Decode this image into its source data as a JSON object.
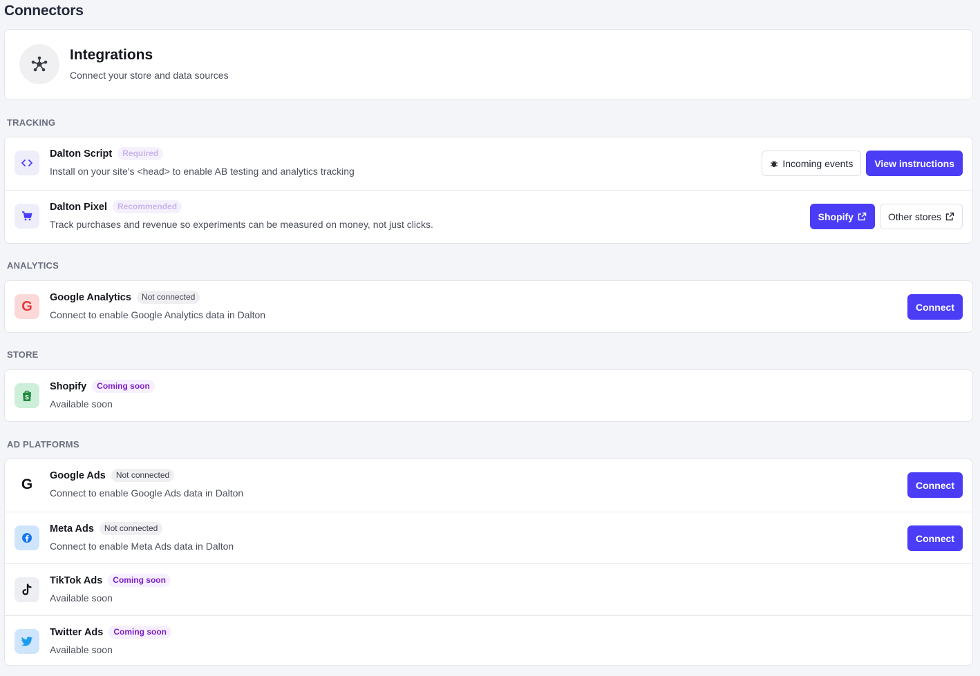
{
  "page": {
    "title": "Connectors"
  },
  "hero": {
    "title": "Integrations",
    "subtitle": "Connect your store and data sources",
    "icon": "network-icon"
  },
  "sections": {
    "tracking": {
      "label": "TRACKING",
      "items": [
        {
          "name": "Dalton Script",
          "badge": "Required",
          "description": "Install on your site's <head> to enable AB testing and analytics tracking",
          "icon": "code-icon",
          "actions": {
            "incoming_events": "Incoming events",
            "view_instructions": "View instructions"
          }
        },
        {
          "name": "Dalton Pixel",
          "badge": "Recommended",
          "description": "Track purchases and revenue so experiments can be measured on money, not just clicks.",
          "icon": "cart-icon",
          "actions": {
            "shopify": "Shopify",
            "other_stores": "Other stores"
          }
        }
      ]
    },
    "analytics": {
      "label": "ANALYTICS",
      "items": [
        {
          "name": "Google Analytics",
          "badge": "Not connected",
          "description": "Connect to enable Google Analytics data in Dalton",
          "icon": "google-analytics-icon",
          "action": "Connect"
        }
      ]
    },
    "store": {
      "label": "STORE",
      "items": [
        {
          "name": "Shopify",
          "badge": "Coming soon",
          "description": "Available soon",
          "icon": "shopify-icon"
        }
      ]
    },
    "ad_platforms": {
      "label": "AD PLATFORMS",
      "items": [
        {
          "name": "Google Ads",
          "badge": "Not connected",
          "description": "Connect to enable Google Ads data in Dalton",
          "icon": "google-icon",
          "action": "Connect"
        },
        {
          "name": "Meta Ads",
          "badge": "Not connected",
          "description": "Connect to enable Meta Ads data in Dalton",
          "icon": "facebook-icon",
          "action": "Connect"
        },
        {
          "name": "TikTok Ads",
          "badge": "Coming soon",
          "description": "Available soon",
          "icon": "tiktok-icon"
        },
        {
          "name": "Twitter Ads",
          "badge": "Coming soon",
          "description": "Available soon",
          "icon": "twitter-icon"
        }
      ]
    }
  },
  "colors": {
    "primary": "#4a3df5",
    "background": "#f4f5f8",
    "coming_soon": "#7c1fc4"
  }
}
